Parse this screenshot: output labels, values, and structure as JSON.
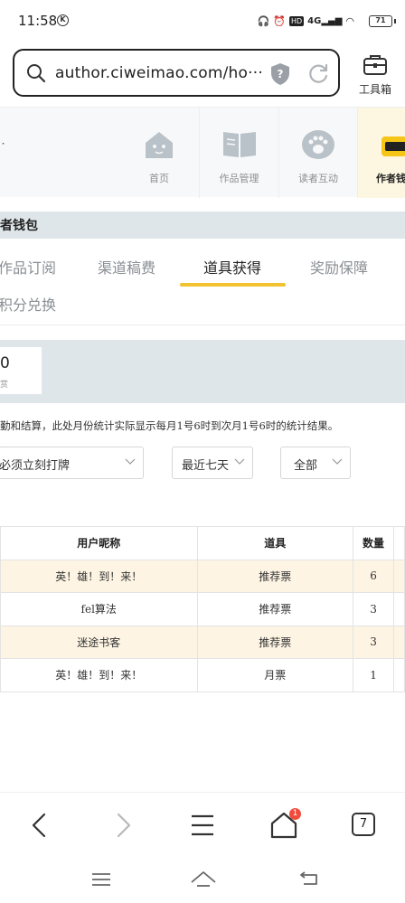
{
  "status_bar": {
    "time": "11:58",
    "k_badge": "K",
    "network": "4G",
    "hd": "HD",
    "battery": "71"
  },
  "address_bar": {
    "url": "author.ciweimao.com/ho···"
  },
  "toolbox": {
    "label": "工具箱"
  },
  "site_nav": {
    "items": [
      {
        "label": "首页",
        "icon": "house-icon"
      },
      {
        "label": "作品管理",
        "icon": "book-icon"
      },
      {
        "label": "读者互动",
        "icon": "paw-icon"
      },
      {
        "label": "作者钱",
        "icon": "wallet-icon"
      }
    ]
  },
  "section": {
    "title": "者钱包"
  },
  "tabs": {
    "items": [
      "作品订阅",
      "渠道稿费",
      "道具获得",
      "奖励保障",
      "积分兑换"
    ],
    "active": "道具获得"
  },
  "stat": {
    "value": "0",
    "label": "赏"
  },
  "notice": "勤和结算，此处月份统计实际显示每月1号6时到次月1号6时的统计结果。",
  "filters": {
    "book": "必须立刻打牌",
    "range": "最近七天",
    "type": "全部"
  },
  "table": {
    "headers": [
      "用户昵称",
      "道具",
      "数量"
    ],
    "rows": [
      [
        "英！雄！到！来！",
        "推荐票",
        "6"
      ],
      [
        "fel算法",
        "推荐票",
        "3"
      ],
      [
        "迷途书客",
        "推荐票",
        "3"
      ],
      [
        "英！雄！到！来！",
        "月票",
        "1"
      ]
    ]
  },
  "browser_bar": {
    "notification_count": "1",
    "tab_count": "7"
  },
  "colors": {
    "accent_yellow": "#f2c230",
    "band_gray": "#dfe6ea",
    "row_highlight": "#fdf4e3",
    "badge_red": "#f04b3c"
  }
}
